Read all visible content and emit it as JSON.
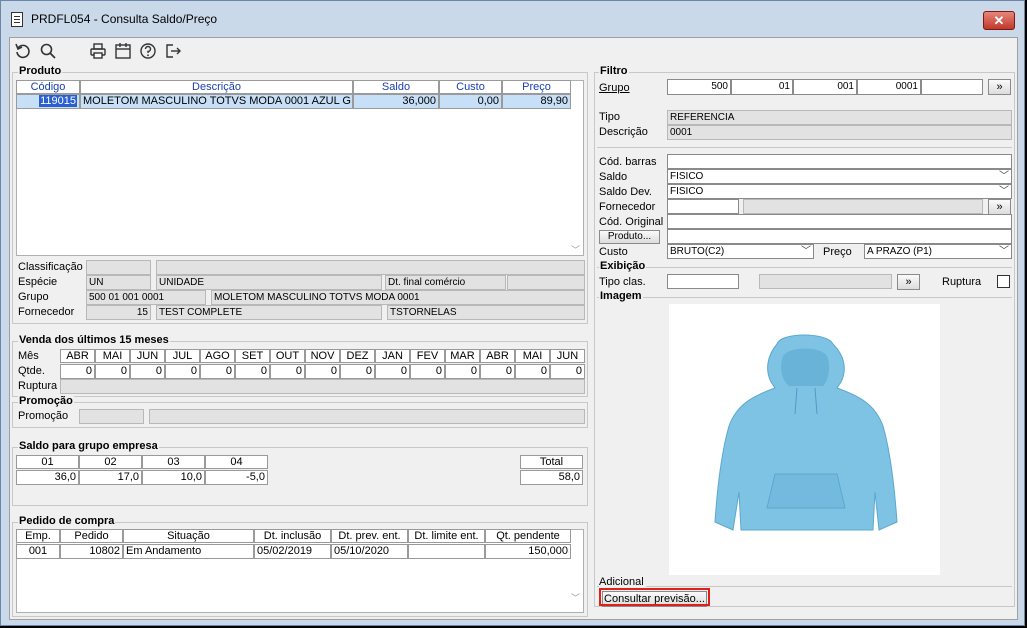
{
  "window": {
    "title": "PRDFL054 - Consulta Saldo/Preço",
    "close_label": "✕"
  },
  "toolbar": [
    "refresh-icon",
    "search-icon",
    "print-icon",
    "calendar-icon",
    "help-icon",
    "exit-icon"
  ],
  "produto": {
    "title": "Produto",
    "headers": [
      "Código",
      "Descrição",
      "Saldo",
      "Custo",
      "Preço"
    ],
    "row": [
      "119015",
      "MOLETOM MASCULINO TOTVS MODA 0001 AZUL G",
      "36,000",
      "0,00",
      "89,90"
    ],
    "classificacao_label": "Classificação",
    "especie_label": "Espécie",
    "especie_code": "UN",
    "especie_desc": "UNIDADE",
    "dt_final_label": "Dt. final comércio",
    "grupo_label": "Grupo",
    "grupo_code": "500 01 001 0001",
    "grupo_desc": "MOLETOM MASCULINO TOTVS MODA 0001",
    "fornecedor_label": "Fornecedor",
    "fornecedor_code": "15",
    "fornecedor_name": "TEST COMPLETE",
    "fornecedor_user": "TSTORNELAS"
  },
  "venda": {
    "title": "Venda dos últimos 15 meses",
    "mes_label": "Mês",
    "qtde_label": "Qtde.",
    "ruptura_label": "Ruptura",
    "months": [
      "ABR",
      "MAI",
      "JUN",
      "JUL",
      "AGO",
      "SET",
      "OUT",
      "NOV",
      "DEZ",
      "JAN",
      "FEV",
      "MAR",
      "ABR",
      "MAI",
      "JUN"
    ],
    "qtde": [
      "0",
      "0",
      "0",
      "0",
      "0",
      "0",
      "0",
      "0",
      "0",
      "0",
      "0",
      "0",
      "0",
      "0",
      "0"
    ]
  },
  "promocao": {
    "title": "Promoção",
    "label": "Promoção"
  },
  "saldo_grupo": {
    "title": "Saldo para grupo empresa",
    "headers": [
      "01",
      "02",
      "03",
      "04"
    ],
    "values": [
      "36,0",
      "17,0",
      "10,0",
      "-5,0"
    ],
    "total_label": "Total",
    "total_value": "58,0"
  },
  "pedido": {
    "title": "Pedido de compra",
    "headers": [
      "Emp.",
      "Pedido",
      "Situação",
      "Dt. inclusão",
      "Dt. prev. ent.",
      "Dt. limite ent.",
      "Qt. pendente"
    ],
    "row": [
      "001",
      "10802",
      "Em Andamento",
      "05/02/2019",
      "05/10/2020",
      "",
      "150,000"
    ]
  },
  "filtro": {
    "title": "Filtro",
    "grupo_label": "Grupo",
    "grupo_values": [
      "500",
      "01",
      "001",
      "0001",
      ""
    ],
    "more_btn": "»",
    "tipo_label": "Tipo",
    "tipo_value": "REFERENCIA",
    "descricao_label": "Descrição",
    "descricao_value": "0001",
    "cod_barras_label": "Cód. barras",
    "cod_barras_value": "",
    "saldo_label": "Saldo",
    "saldo_value": "FISICO",
    "saldo_dev_label": "Saldo Dev.",
    "saldo_dev_value": "FISICO",
    "fornecedor_label": "Fornecedor",
    "cod_original_label": "Cód. Original",
    "produto_btn": "Produto...",
    "custo_label": "Custo",
    "custo_value": "BRUTO(C2)",
    "preco_label": "Preço",
    "preco_value": "A PRAZO (P1)"
  },
  "exibicao": {
    "title": "Exibição",
    "tipo_clas_label": "Tipo clas.",
    "ruptura_label": "Ruptura"
  },
  "imagem": {
    "title": "Imagem"
  },
  "adicional": {
    "label": "Adicional",
    "consultar_btn": "Consultar previsão..."
  },
  "colors": {
    "selection": "#c7e0f8",
    "highlight": "#e0201a",
    "hoodie": "#7fc3e4"
  }
}
